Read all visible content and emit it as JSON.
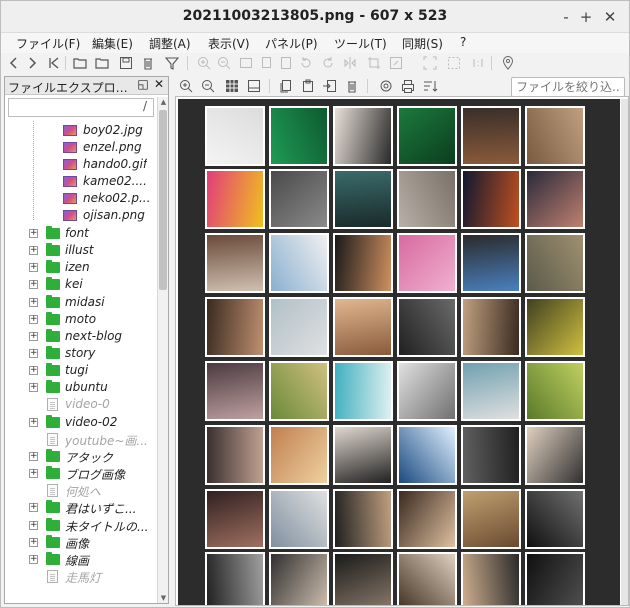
{
  "window": {
    "title": "20211003213805.png - 607 x 523",
    "minimize": "-",
    "maximize": "+",
    "close": "✕"
  },
  "menu": {
    "file": "ファイル(F)",
    "edit": "編集(E)",
    "adjust": "調整(A)",
    "view": "表示(V)",
    "panel": "パネル(P)",
    "tools": "ツール(T)",
    "sync": "同期(S)",
    "help": "?"
  },
  "explorer": {
    "title": "ファイルエクスプロ…",
    "float_btn": "◱",
    "close_btn": "✕",
    "path": "/",
    "files": [
      "boy02.jpg",
      "enzel.png",
      "hando0.gif",
      "kame02....",
      "neko02.p...",
      "ojisan.png"
    ],
    "folders": [
      {
        "label": "font",
        "type": "folder"
      },
      {
        "label": "illust",
        "type": "folder"
      },
      {
        "label": "izen",
        "type": "folder"
      },
      {
        "label": "kei",
        "type": "folder"
      },
      {
        "label": "midasi",
        "type": "folder"
      },
      {
        "label": "moto",
        "type": "folder"
      },
      {
        "label": "next-blog",
        "type": "folder"
      },
      {
        "label": "story",
        "type": "folder"
      },
      {
        "label": "tugi",
        "type": "folder"
      },
      {
        "label": "ubuntu",
        "type": "folder"
      },
      {
        "label": "video-0",
        "type": "file"
      },
      {
        "label": "video-02",
        "type": "folder"
      },
      {
        "label": "youtube~画...",
        "type": "file"
      },
      {
        "label": "アタック",
        "type": "folder"
      },
      {
        "label": "ブログ画像",
        "type": "folder"
      },
      {
        "label": "何処へ",
        "type": "file"
      },
      {
        "label": "君はいずこ...",
        "type": "folder"
      },
      {
        "label": "未タイトルの...",
        "type": "folder"
      },
      {
        "label": "画像",
        "type": "folder"
      },
      {
        "label": "線画",
        "type": "folder"
      },
      {
        "label": "走馬灯",
        "type": "file"
      }
    ]
  },
  "search": {
    "placeholder": "ファイルを絞り込..."
  },
  "colors": {
    "folder": "#2fae39",
    "grid_background": "#2c2c2c"
  }
}
